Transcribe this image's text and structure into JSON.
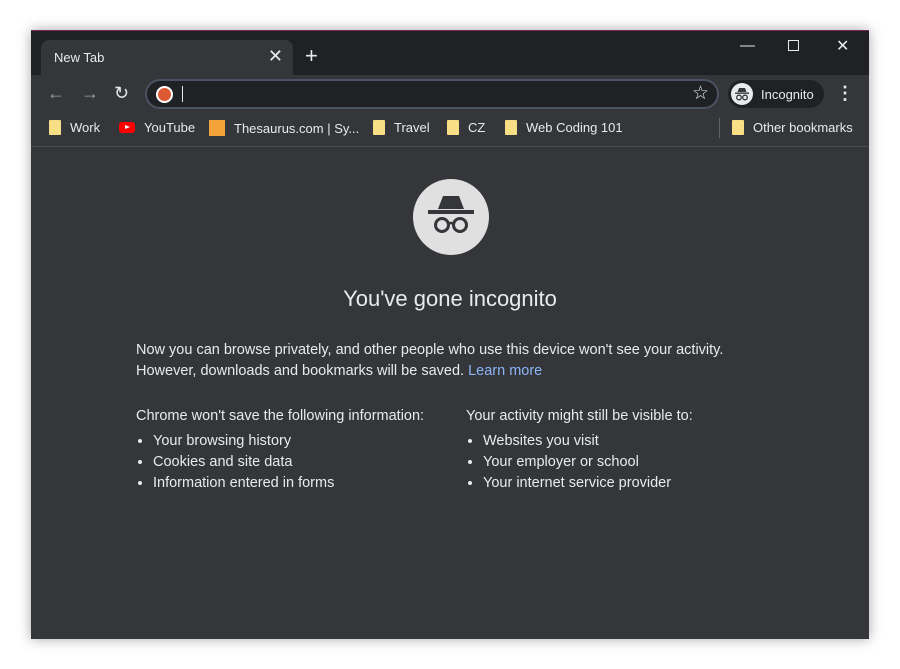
{
  "tab": {
    "title": "New Tab"
  },
  "profile": {
    "label": "Incognito"
  },
  "omnibox": {
    "value": ""
  },
  "bookmarks": [
    {
      "label": "Work",
      "icon": "folder-icon"
    },
    {
      "label": "YouTube",
      "icon": "youtube-icon"
    },
    {
      "label": "Thesaurus.com | Sy...",
      "icon": "thesaurus-icon"
    },
    {
      "label": "Travel",
      "icon": "folder-icon"
    },
    {
      "label": "CZ",
      "icon": "folder-icon"
    },
    {
      "label": "Web Coding 101",
      "icon": "folder-icon"
    }
  ],
  "other_bookmarks": "Other bookmarks",
  "page": {
    "title": "You've gone incognito",
    "intro": "Now you can browse privately, and other people who use this device won't see your activity. However, downloads and bookmarks will be saved.",
    "learn_more": "Learn more",
    "left_heading": "Chrome won't save the following information:",
    "left_items": [
      "Your browsing history",
      "Cookies and site data",
      "Information entered in forms"
    ],
    "right_heading": "Your activity might still be visible to:",
    "right_items": [
      "Websites you visit",
      "Your employer or school",
      "Your internet service provider"
    ]
  },
  "colors": {
    "link": "#8ab4f8",
    "background": "#35363a",
    "titlebar": "#202124"
  }
}
